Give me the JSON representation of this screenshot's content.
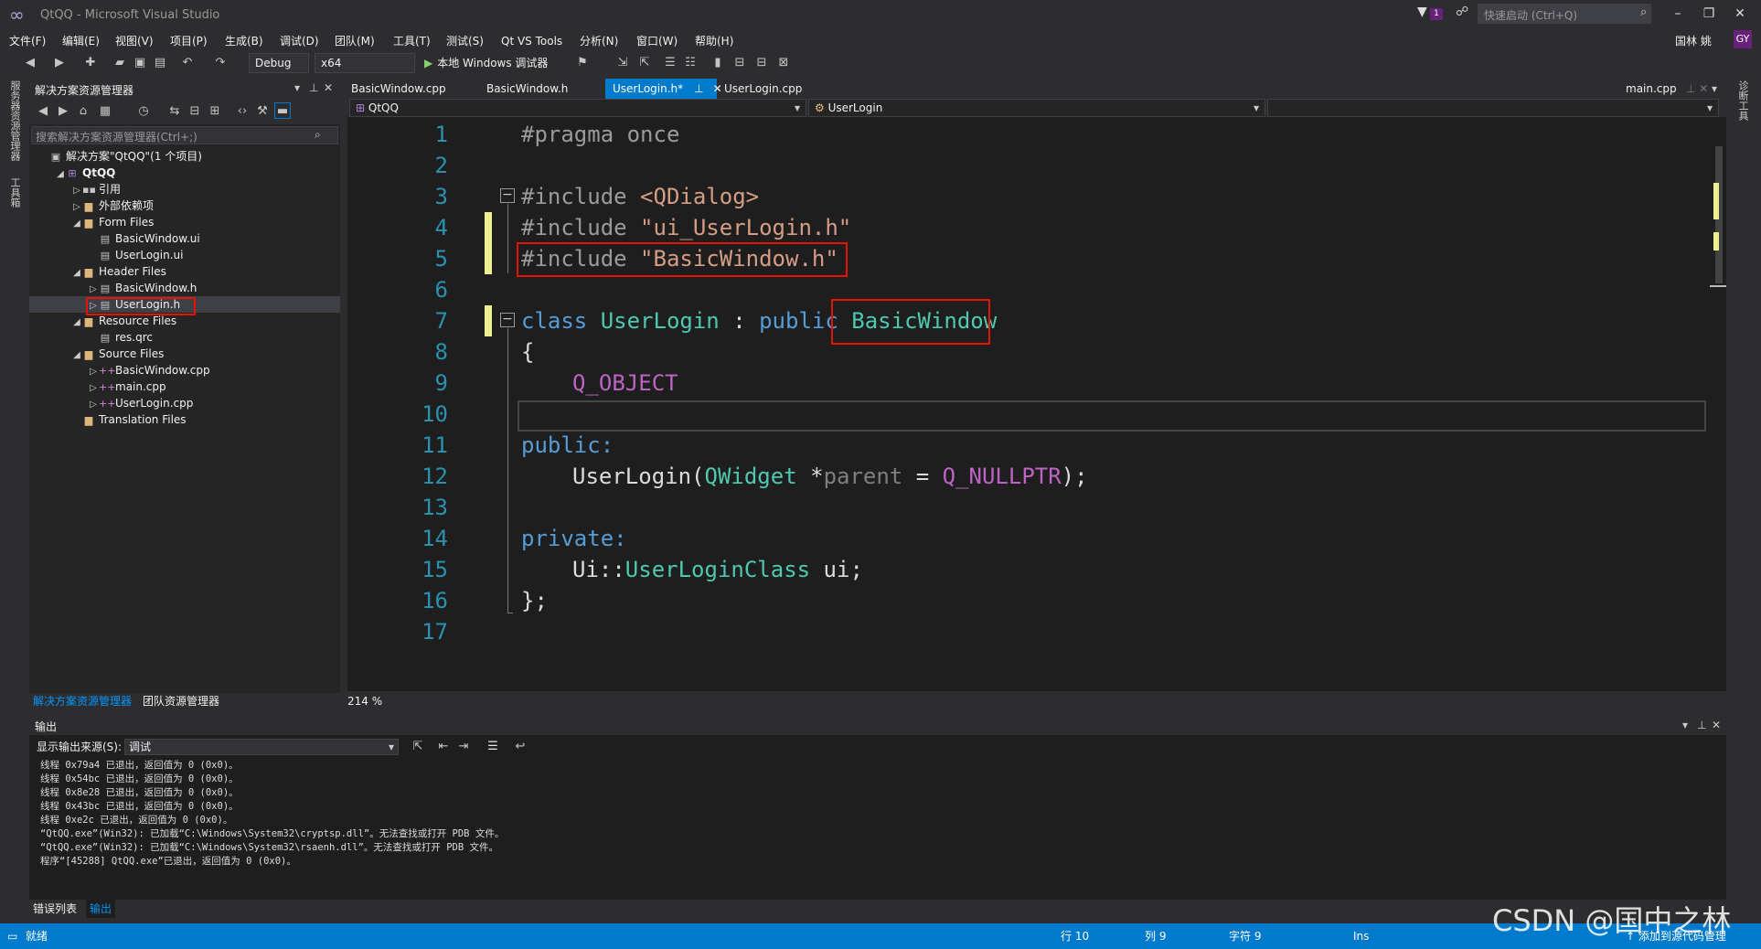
{
  "app": {
    "title": "QtQQ - Microsoft Visual Studio",
    "quick_launch": "快速启动 (Ctrl+Q)",
    "notification_count": "1",
    "user_name": "国林 姚",
    "user_avatar": "GY"
  },
  "menu": [
    "文件(F)",
    "编辑(E)",
    "视图(V)",
    "项目(P)",
    "生成(B)",
    "调试(D)",
    "团队(M)",
    "工具(T)",
    "测试(S)",
    "Qt VS Tools",
    "分析(N)",
    "窗口(W)",
    "帮助(H)"
  ],
  "toolbar": {
    "config": "Debug",
    "platform": "x64",
    "run_label": "本地 Windows 调试器"
  },
  "left_strip": {
    "server_explorer": "服务器资源管理器",
    "toolbox": "工具箱"
  },
  "right_strip": {
    "diagnostics": "诊断工具"
  },
  "solution_explorer": {
    "title": "解决方案资源管理器",
    "search_placeholder": "搜索解决方案资源管理器(Ctrl+;)",
    "tree": [
      {
        "label": "解决方案\"QtQQ\"(1 个项目)",
        "indent": 0,
        "arrow": "",
        "icon": "solution-icon",
        "glyph": "▣"
      },
      {
        "label": "QtQQ",
        "indent": 1,
        "arrow": "◢",
        "icon": "project-icon",
        "glyph": "⊞",
        "bold": true
      },
      {
        "label": "引用",
        "indent": 2,
        "arrow": "▷",
        "icon": "references-icon",
        "glyph": "▪▪"
      },
      {
        "label": "外部依赖项",
        "indent": 2,
        "arrow": "▷",
        "icon": "folder-icon",
        "glyph": "▆"
      },
      {
        "label": "Form Files",
        "indent": 2,
        "arrow": "◢",
        "icon": "folder-icon",
        "glyph": "▆"
      },
      {
        "label": "BasicWindow.ui",
        "indent": 3,
        "arrow": "",
        "icon": "ui-file-icon",
        "glyph": "▤"
      },
      {
        "label": "UserLogin.ui",
        "indent": 3,
        "arrow": "",
        "icon": "ui-file-icon",
        "glyph": "▤"
      },
      {
        "label": "Header Files",
        "indent": 2,
        "arrow": "◢",
        "icon": "folder-icon",
        "glyph": "▆"
      },
      {
        "label": "BasicWindow.h",
        "indent": 3,
        "arrow": "▷",
        "icon": "header-file-icon",
        "glyph": "▤"
      },
      {
        "label": "UserLogin.h",
        "indent": 3,
        "arrow": "▷",
        "icon": "header-file-icon",
        "glyph": "▤",
        "selected": true
      },
      {
        "label": "Resource Files",
        "indent": 2,
        "arrow": "◢",
        "icon": "folder-icon",
        "glyph": "▆"
      },
      {
        "label": "res.qrc",
        "indent": 3,
        "arrow": "",
        "icon": "qrc-file-icon",
        "glyph": "▤"
      },
      {
        "label": "Source Files",
        "indent": 2,
        "arrow": "◢",
        "icon": "folder-icon",
        "glyph": "▆"
      },
      {
        "label": "BasicWindow.cpp",
        "indent": 3,
        "arrow": "▷",
        "icon": "cpp-file-icon",
        "glyph": "++"
      },
      {
        "label": "main.cpp",
        "indent": 3,
        "arrow": "▷",
        "icon": "cpp-file-icon",
        "glyph": "++"
      },
      {
        "label": "UserLogin.cpp",
        "indent": 3,
        "arrow": "▷",
        "icon": "cpp-file-icon",
        "glyph": "++"
      },
      {
        "label": "Translation Files",
        "indent": 2,
        "arrow": "",
        "icon": "folder-icon",
        "glyph": "▆"
      }
    ],
    "tabs": [
      "解决方案资源管理器",
      "团队资源管理器"
    ]
  },
  "editor": {
    "tabs": [
      "BasicWindow.cpp",
      "BasicWindow.h",
      "UserLogin.h*",
      "UserLogin.cpp"
    ],
    "active_tab": "UserLogin.h*",
    "pinned_tab": "main.cpp",
    "nav_project": "QtQQ",
    "nav_scope": "UserLogin",
    "zoom": "214 %",
    "line_numbers": [
      "1",
      "2",
      "3",
      "4",
      "5",
      "6",
      "7",
      "8",
      "9",
      "10",
      "11",
      "12",
      "13",
      "14",
      "15",
      "16",
      "17"
    ],
    "code": {
      "l1": "#pragma once",
      "l3_a": "#include ",
      "l3_b": "<QDialog>",
      "l4_a": "#include ",
      "l4_b": "\"ui_UserLogin.h\"",
      "l5_a": "#include ",
      "l5_b": "\"BasicWindow.h\"",
      "l7_a": "class ",
      "l7_b": "UserLogin",
      "l7_c": " : ",
      "l7_d": "public ",
      "l7_e": "BasicWindow",
      "l8": "{",
      "l9": "Q_OBJECT",
      "l11": "public:",
      "l12_a": "UserLogin(",
      "l12_b": "QWidget",
      "l12_c": " *",
      "l12_d": "parent",
      "l12_e": " = ",
      "l12_f": "Q_NULLPTR",
      "l12_g": ");",
      "l14": "private:",
      "l15_a": "Ui::",
      "l15_b": "UserLoginClass",
      "l15_c": " ui;",
      "l16": "};"
    }
  },
  "output": {
    "title": "输出",
    "source_label": "显示输出来源(S):",
    "source_value": "调试",
    "lines": [
      "线程 0x79a4 已退出，返回值为 0 (0x0)。",
      "线程 0x54bc 已退出，返回值为 0 (0x0)。",
      "线程 0x8e28 已退出，返回值为 0 (0x0)。",
      "线程 0x43bc 已退出，返回值为 0 (0x0)。",
      "线程 0xe2c 已退出，返回值为 0 (0x0)。",
      "“QtQQ.exe”(Win32): 已加载“C:\\Windows\\System32\\cryptsp.dll”。无法查找或打开 PDB 文件。",
      "“QtQQ.exe”(Win32): 已加载“C:\\Windows\\System32\\rsaenh.dll”。无法查找或打开 PDB 文件。",
      "程序“[45288] QtQQ.exe”已退出，返回值为 0 (0x0)。"
    ],
    "tabs": [
      "错误列表",
      "输出"
    ]
  },
  "status": {
    "ready": "就绪",
    "line": "行 10",
    "col": "列 9",
    "char": "字符 9",
    "mode": "Ins",
    "source_control": "添加到源代码管理"
  },
  "watermark": "CSDN @国中之林",
  "colors": {
    "accent": "#007acc",
    "highlight_box": "#e51400",
    "keyword": "#569cd6",
    "type": "#4ec9b0",
    "string": "#d69d85",
    "macro": "#bd63c5"
  }
}
